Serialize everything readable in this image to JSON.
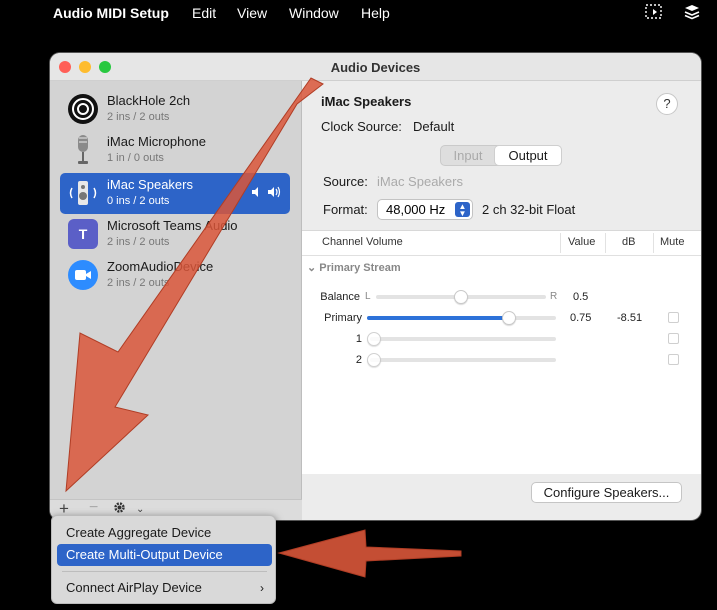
{
  "menubar": {
    "app_name": "Audio MIDI Setup",
    "menus": [
      "Edit",
      "View",
      "Window",
      "Help"
    ]
  },
  "window": {
    "title": "Audio Devices"
  },
  "devices": [
    {
      "name": "BlackHole 2ch",
      "io": "2 ins / 2 outs",
      "icon": "blackhole-icon",
      "color": "#111111"
    },
    {
      "name": "iMac Microphone",
      "io": "1 in / 0 outs",
      "icon": "microphone-icon",
      "color": "#8a8a8a"
    },
    {
      "name": "iMac Speakers",
      "io": "0 ins / 2 outs",
      "icon": "speaker-icon",
      "color": "#2d64c8",
      "selected": true
    },
    {
      "name": "Microsoft Teams Audio",
      "io": "2 ins / 2 outs",
      "icon": "teams-icon",
      "color": "#5b5fc7"
    },
    {
      "name": "ZoomAudioDevice",
      "io": "2 ins / 2 outs",
      "icon": "zoom-icon",
      "color": "#2d8cff"
    }
  ],
  "detail": {
    "device_name": "iMac Speakers",
    "help": "?",
    "clock_label": "Clock Source:",
    "clock_value": "Default",
    "seg_input": "Input",
    "seg_output": "Output",
    "source_label": "Source:",
    "source_value": "iMac Speakers",
    "format_label": "Format:",
    "format_value": "48,000 Hz",
    "format_extra": "2 ch 32-bit Float",
    "columns": {
      "channel_volume": "Channel Volume",
      "value": "Value",
      "db": "dB",
      "mute": "Mute"
    },
    "stream_label": "Primary Stream",
    "balance": {
      "label": "Balance",
      "left": "L",
      "right": "R",
      "value": "0.5",
      "level": 0.5
    },
    "primary": {
      "label": "Primary",
      "value": "0.75",
      "db": "-8.51",
      "level": 0.75
    },
    "channels": [
      {
        "label": "1",
        "level": 0
      },
      {
        "label": "2",
        "level": 0
      }
    ],
    "configure_button": "Configure Speakers..."
  },
  "popup_menu": {
    "items": [
      {
        "label": "Create Aggregate Device"
      },
      {
        "label": "Create Multi-Output Device",
        "highlighted": true
      },
      {
        "label": "Connect AirPlay Device"
      }
    ]
  },
  "colors": {
    "accent": "#2d64c8",
    "annotation_arrow": "#d9563a"
  }
}
